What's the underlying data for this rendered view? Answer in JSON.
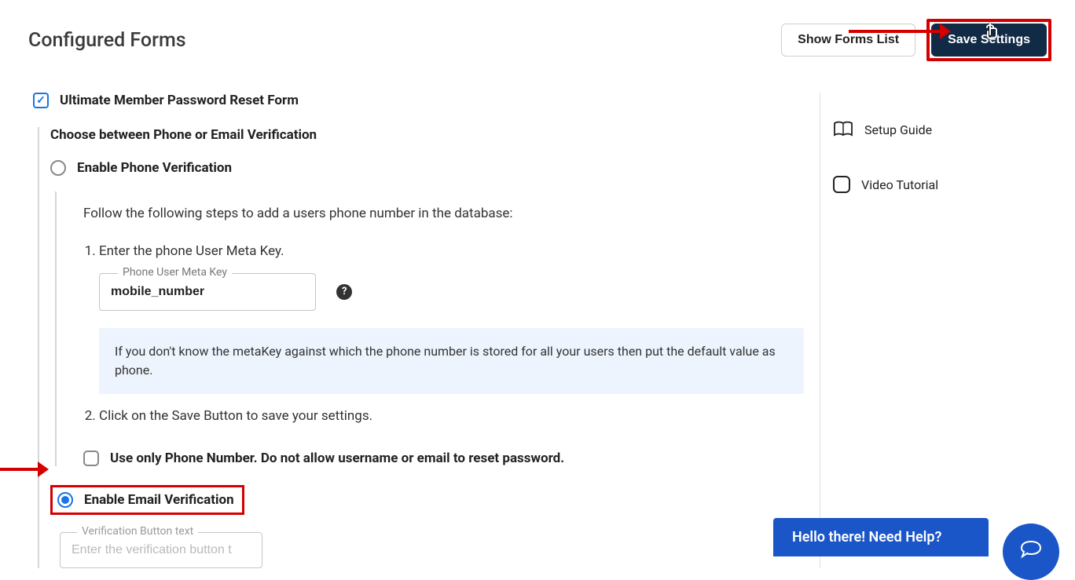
{
  "header": {
    "title": "Configured Forms",
    "show_forms_list": "Show Forms List",
    "save_settings": "Save Settings"
  },
  "form": {
    "main_checkbox_label": "Ultimate Member Password Reset Form",
    "choose_label": "Choose between Phone or Email Verification",
    "enable_phone_label": "Enable Phone Verification",
    "enable_email_label": "Enable Email Verification",
    "steps_intro": "Follow the following steps to add a users phone number in the database:",
    "step1": "Enter the phone User Meta Key.",
    "step2": "Click on the Save Button to save your settings.",
    "phone_meta_key_label": "Phone User Meta Key",
    "phone_meta_key_value": "mobile_number",
    "info_text": "If you don't know the metaKey against which the phone number is stored for all your users then put the default value as phone.",
    "only_phone_label": "Use only Phone Number. Do not allow username or email to reset password.",
    "verification_button_label": "Verification Button text",
    "verification_button_placeholder": "Enter the verification button t"
  },
  "sidebar": {
    "setup_guide": "Setup Guide",
    "video_tutorial": "Video Tutorial"
  },
  "chat": {
    "help_text": "Hello there! Need Help?"
  }
}
